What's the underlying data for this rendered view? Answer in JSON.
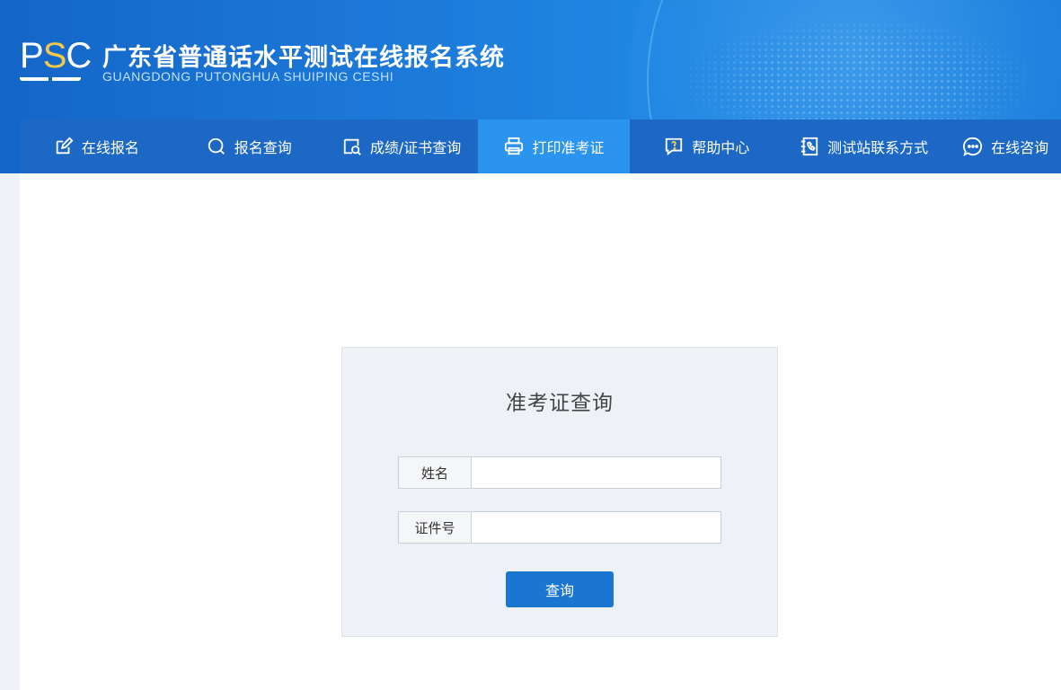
{
  "header": {
    "logo_text_left": "P",
    "logo_text_mid": "S",
    "logo_text_right": "C",
    "title": "广东省普通话水平测试在线报名系统",
    "subtitle": "GUANGDONG PUTONGHUA SHUIPING CESHI"
  },
  "nav": {
    "items": [
      {
        "label": "在线报名",
        "icon": "edit-icon"
      },
      {
        "label": "报名查询",
        "icon": "search-icon"
      },
      {
        "label": "成绩/证书查询",
        "icon": "certificate-search-icon"
      },
      {
        "label": "打印准考证",
        "icon": "printer-icon"
      },
      {
        "label": "帮助中心",
        "icon": "help-chat-icon"
      },
      {
        "label": "测试站联系方式",
        "icon": "phone-book-icon"
      },
      {
        "label": "在线咨询",
        "icon": "chat-icon"
      }
    ],
    "active_index": 3
  },
  "form": {
    "title": "准考证查询",
    "name_label": "姓名",
    "name_value": "",
    "id_label": "证件号",
    "id_value": "",
    "submit_label": "查询"
  },
  "colors": {
    "header_blue": "#1c78d8",
    "nav_blue": "#1c68c4",
    "nav_active": "#2b94ee",
    "button_blue": "#1b76d2",
    "logo_accent": "#f5c94a"
  }
}
